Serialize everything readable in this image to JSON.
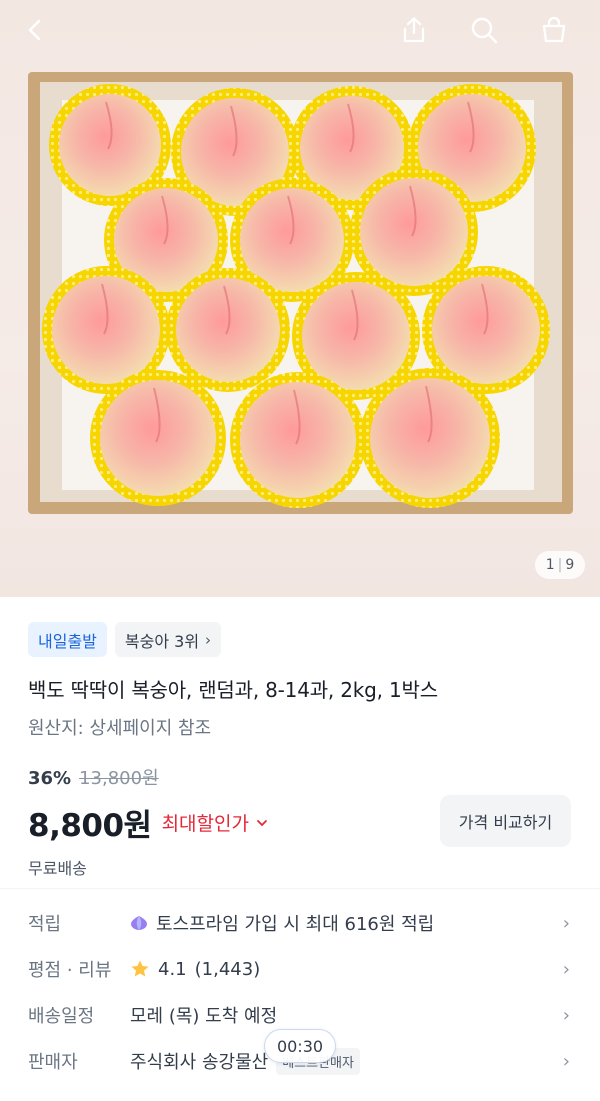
{
  "header": {
    "back_icon": "chevron-left-icon",
    "share_icon": "share-icon",
    "search_icon": "search-icon",
    "cart_icon": "shopping-bag-icon"
  },
  "gallery": {
    "current": "1",
    "total": "9",
    "image": "peaches-in-box-photo"
  },
  "tags": {
    "delivery": "내일출발",
    "rank": "복숭아 3위"
  },
  "product": {
    "title": "백도 딱딱이 복숭아, 랜덤과, 8-14과, 2kg, 1박스",
    "origin": "원산지: 상세페이지 참조",
    "discount_rate": "36%",
    "original_price": "13,800원",
    "price": "8,800원",
    "max_discount_label": "최대할인가",
    "compare_label": "가격 비교하기",
    "shipping": "무료배송"
  },
  "info_rows": [
    {
      "label": "적립",
      "value": "토스프라임 가입 시 최대 616원 적립",
      "icon": "toss-prime-icon"
    },
    {
      "label": "평점 · 리뷰",
      "rating": "4.1",
      "count": "(1,443)",
      "icon": "star-icon"
    },
    {
      "label": "배송일정",
      "value": "모레 (목) 도착 예정"
    },
    {
      "label": "판매자",
      "value": "주식회사 송강물산",
      "badge": "베스트판매자"
    }
  ],
  "timer": "00:30",
  "colors": {
    "accent_blue": "#1b64da",
    "discount_red": "#e42939",
    "net_yellow": "#f7d500"
  }
}
